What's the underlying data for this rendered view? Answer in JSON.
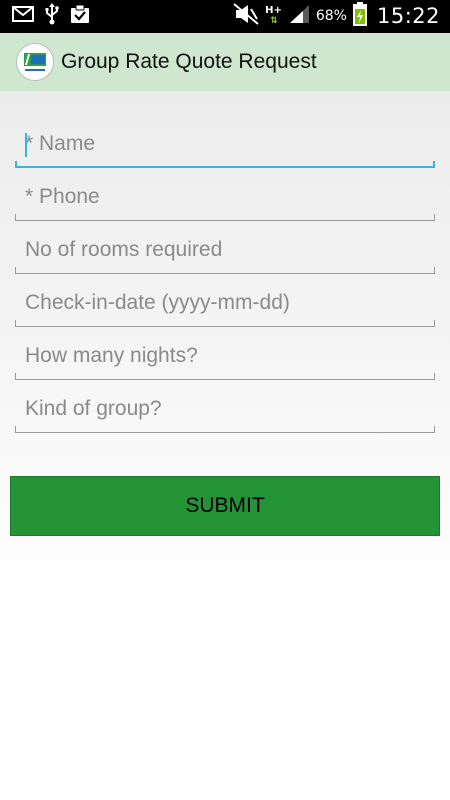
{
  "status_bar": {
    "battery_percent": "68%",
    "time": "15:22",
    "network_type": "H+",
    "icons": [
      "mail-icon",
      "usb-icon",
      "clipboard-check-icon",
      "mute-icon",
      "network-hplus-icon",
      "signal-icon",
      "battery-charging-icon"
    ]
  },
  "action_bar": {
    "title": "Group Rate Quote Request",
    "logo_icon": "hotel-logo-icon"
  },
  "form": {
    "fields": [
      {
        "placeholder": "* Name",
        "value": ""
      },
      {
        "placeholder": "* Phone",
        "value": ""
      },
      {
        "placeholder": "No of rooms required",
        "value": ""
      },
      {
        "placeholder": "Check-in-date (yyyy-mm-dd)",
        "value": ""
      },
      {
        "placeholder": "How many nights?",
        "value": ""
      },
      {
        "placeholder": "Kind of group?",
        "value": ""
      }
    ],
    "submit_label": "SUBMIT"
  },
  "colors": {
    "action_bar_bg": "#cfe6cf",
    "focus_accent": "#33b5e5",
    "submit_bg": "#239336",
    "battery_charging": "#7cc000"
  }
}
